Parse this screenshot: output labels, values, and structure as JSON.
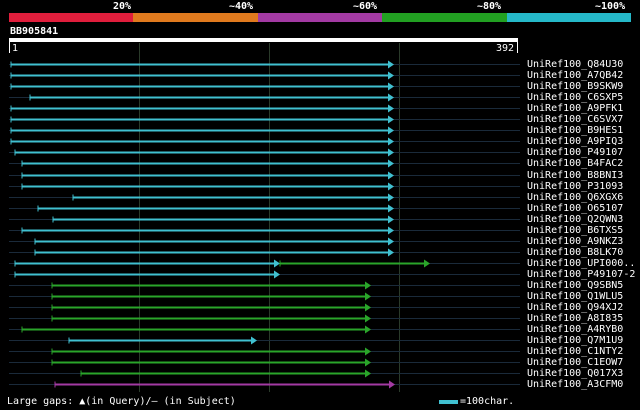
{
  "coverage_scale": {
    "labels": [
      "20%",
      "~40%",
      "~60%",
      "~80%",
      "~100%"
    ],
    "colors": [
      "#e01e3c",
      "#e07a1e",
      "#a33aa3",
      "#22a022",
      "#25b8c8"
    ]
  },
  "query": {
    "id": "BB905841",
    "start": "1",
    "end": "392"
  },
  "hit_colors": {
    "cyan": "#40c0d0",
    "green": "#2aa52a",
    "purple": "#a33aa3",
    "gap_dark": "#1a2a3a"
  },
  "hits": [
    {
      "name": "UniRef100_Q84U30",
      "color": "cyan"
    },
    {
      "name": "UniRef100_A7QB42",
      "color": "cyan"
    },
    {
      "name": "UniRef100_B9SKW9",
      "color": "cyan"
    },
    {
      "name": "UniRef100_C6SXP5",
      "color": "cyan"
    },
    {
      "name": "UniRef100_A9PFK1",
      "color": "cyan"
    },
    {
      "name": "UniRef100_C6SVX7",
      "color": "cyan"
    },
    {
      "name": "UniRef100_B9HES1",
      "color": "cyan"
    },
    {
      "name": "UniRef100_A9PIQ3",
      "color": "cyan"
    },
    {
      "name": "UniRef100_P49107",
      "color": "cyan"
    },
    {
      "name": "UniRef100_B4FAC2",
      "color": "cyan"
    },
    {
      "name": "UniRef100_B8BNI3",
      "color": "cyan"
    },
    {
      "name": "UniRef100_P31093",
      "color": "cyan"
    },
    {
      "name": "UniRef100_Q6XGX6",
      "color": "cyan"
    },
    {
      "name": "UniRef100_O65107",
      "color": "cyan"
    },
    {
      "name": "UniRef100_Q2QWN3",
      "color": "cyan"
    },
    {
      "name": "UniRef100_B6TXS5",
      "color": "cyan"
    },
    {
      "name": "UniRef100_A9NKZ3",
      "color": "cyan"
    },
    {
      "name": "UniRef100_B8LK70",
      "color": "cyan"
    },
    {
      "name": "UniRef100_UPI000..",
      "color": "cyan-green"
    },
    {
      "name": "UniRef100_P49107-2",
      "color": "cyan"
    },
    {
      "name": "UniRef100_Q9SBN5",
      "color": "green"
    },
    {
      "name": "UniRef100_Q1WLU5",
      "color": "green"
    },
    {
      "name": "UniRef100_Q94XJ2",
      "color": "green"
    },
    {
      "name": "UniRef100_A8I835",
      "color": "green"
    },
    {
      "name": "UniRef100_A4RYB0",
      "color": "green"
    },
    {
      "name": "UniRef100_Q7M1U9",
      "color": "cyan"
    },
    {
      "name": "UniRef100_C1NTY2",
      "color": "green"
    },
    {
      "name": "UniRef100_C1EOW7",
      "color": "green"
    },
    {
      "name": "UniRef100_Q017X3",
      "color": "green"
    },
    {
      "name": "UniRef100_A3CFM0",
      "color": "purple"
    }
  ],
  "legend": {
    "gaps_text": "Large gaps: ▲(in Query)/— (in Subject)",
    "scale_text": "=100char."
  }
}
